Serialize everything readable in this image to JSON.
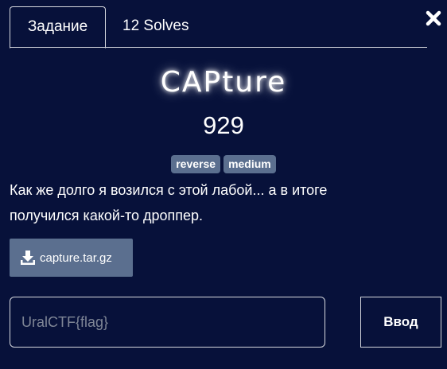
{
  "tabs": [
    {
      "label": "Задание",
      "active": true
    },
    {
      "label": "12 Solves",
      "active": false
    }
  ],
  "close_icon": "close-icon",
  "challenge": {
    "name": "CAPture",
    "points": "929",
    "tags": [
      "reverse",
      "medium"
    ],
    "description_lines": [
      "Как же долго я возился с этой лабой... а в итоге",
      "получился какой-то дроппер."
    ]
  },
  "file": {
    "icon": "download-icon",
    "name": "capture.tar.gz"
  },
  "submission": {
    "placeholder": "UralCTF{flag}",
    "value": "",
    "submit_label": "Ввод"
  },
  "colors": {
    "background": "#07113a",
    "tag_bg": "#5b6f8f",
    "button_bg": "#5b6f8f",
    "border": "#d7d9df"
  }
}
